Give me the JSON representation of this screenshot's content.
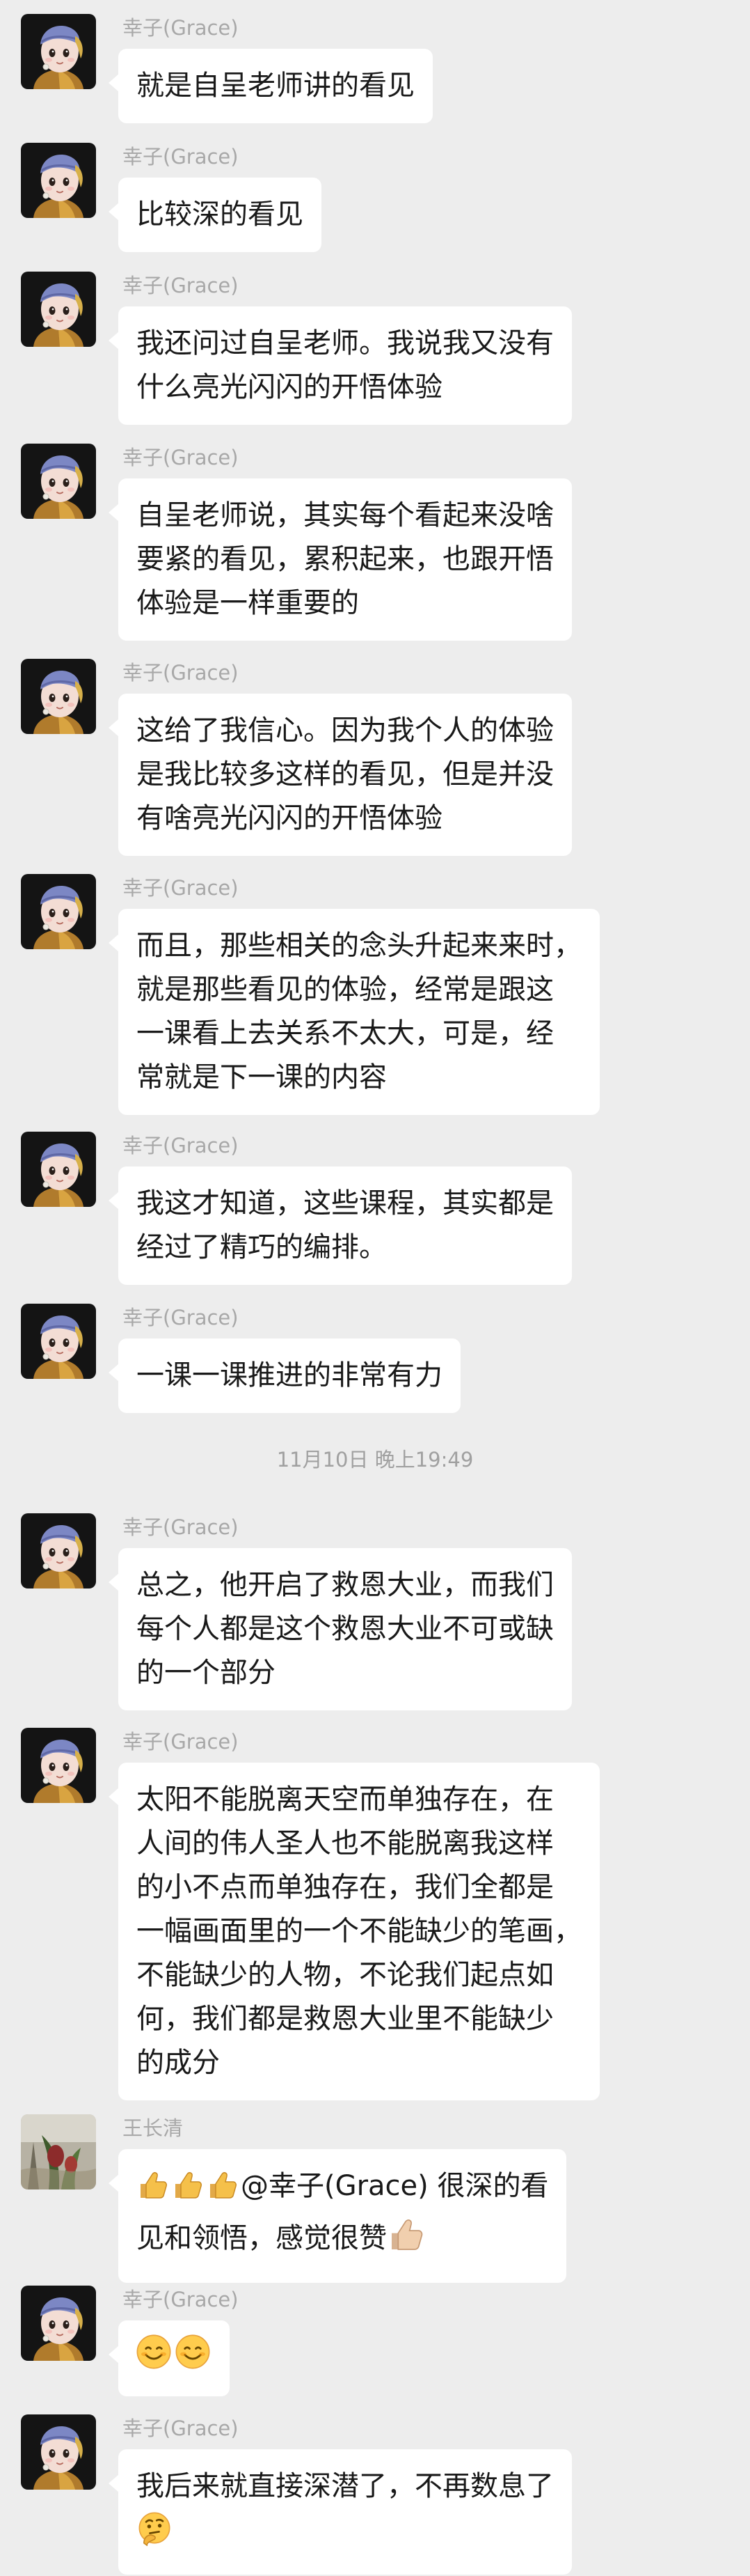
{
  "messages": [
    {
      "sender": "幸子(Grace)",
      "text": "就是自呈老师讲的看见"
    },
    {
      "sender": "幸子(Grace)",
      "text": "比较深的看见"
    },
    {
      "sender": "幸子(Grace)",
      "lines": [
        "我还问过自呈老师。我说我又没有",
        "什么亮光闪闪的开悟体验"
      ]
    },
    {
      "sender": "幸子(Grace)",
      "lines": [
        "自呈老师说，其实每个看起来没啥",
        "要紧的看见，累积起来，也跟开悟",
        "体验是一样重要的"
      ]
    },
    {
      "sender": "幸子(Grace)",
      "lines": [
        "这给了我信心。因为我个人的体验",
        "是我比较多这样的看见，但是并没",
        "有啥亮光闪闪的开悟体验"
      ]
    },
    {
      "sender": "幸子(Grace)",
      "lines": [
        "而且，那些相关的念头升起来来时，",
        "就是那些看见的体验，经常是跟这",
        "一课看上去关系不太大，可是，经",
        "常就是下一课的内容"
      ]
    },
    {
      "sender": "幸子(Grace)",
      "lines": [
        "我这才知道，这些课程，其实都是",
        "经过了精巧的编排。"
      ]
    },
    {
      "sender": "幸子(Grace)",
      "text": "一课一课推进的非常有力"
    },
    {
      "sender": "幸子(Grace)",
      "lines": [
        "总之，他开启了救恩大业，而我们",
        "每个人都是这个救恩大业不可或缺",
        "的一个部分"
      ]
    },
    {
      "sender": "幸子(Grace)",
      "lines": [
        "太阳不能脱离天空而单独存在，在",
        "人间的伟人圣人也不能脱离我这样",
        "的小不点而单独存在，我们全都是",
        "一幅画面里的一个不能缺少的笔画，",
        "不能缺少的人物，不论我们起点如",
        "何，我们都是救恩大业里不能缺少",
        "的成分"
      ]
    },
    {
      "sender": "王长清",
      "line1_after_emoji": "@幸子(Grace)  很深的看",
      "line2": "见和领悟，感觉很赞",
      "emoji_names": [
        "thumbs-up-icon",
        "thumbs-up-icon",
        "thumbs-up-icon",
        "thumbs-up-light-icon"
      ]
    },
    {
      "sender": "幸子(Grace)",
      "emoji_names": [
        "smiling-face-icon",
        "smiling-face-icon"
      ]
    },
    {
      "sender": "幸子(Grace)",
      "line1": "我后来就直接深潜了，不再数息了",
      "emoji_names": [
        "thinking-face-icon"
      ]
    }
  ],
  "timestamp": "11月10日 晚上19:49",
  "colors": {
    "background": "#ededed",
    "bubble": "#ffffff",
    "sender_name": "#a8a8a8",
    "timestamp": "#a0a0a0"
  }
}
